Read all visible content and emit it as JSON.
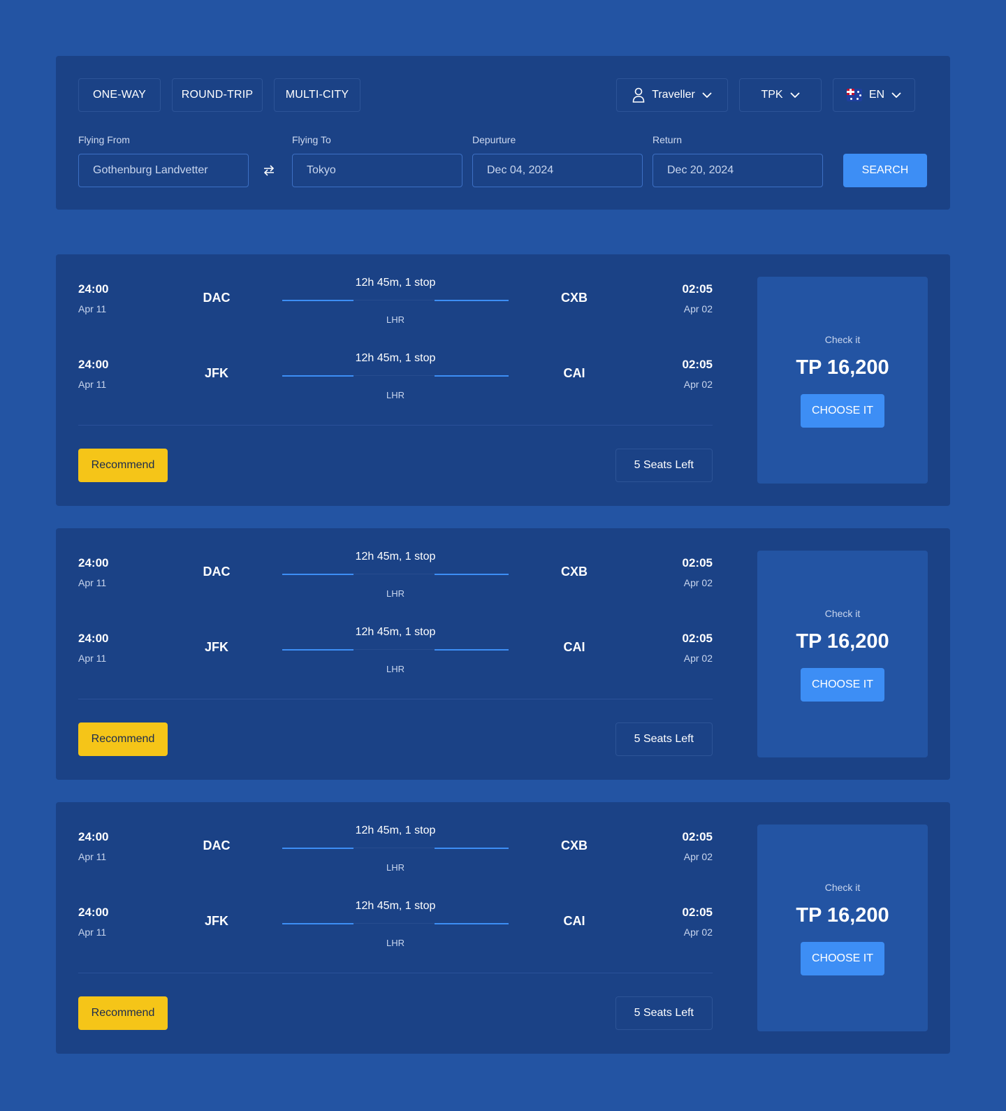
{
  "trip_types": [
    "ONE-WAY",
    "ROUND-TRIP",
    "MULTI-CITY"
  ],
  "traveller": {
    "label": "Traveller",
    "icon": "user-icon"
  },
  "currency": {
    "label": "TPK"
  },
  "language": {
    "label": "EN",
    "flag": "australia-flag-icon"
  },
  "form": {
    "from_label": "Flying From",
    "from_value": "Gothenburg Landvetter",
    "to_label": "Flying To",
    "to_value": "Tokyo",
    "departure_label": "Depurture",
    "departure_value": "Dec 04, 2024",
    "return_label": "Return",
    "return_value": "Dec 20, 2024",
    "search_label": "SEARCH"
  },
  "results": [
    {
      "legs": [
        {
          "dep_time": "24:00",
          "dep_date": "Apr 11",
          "dep_code": "DAC",
          "duration": "12h 45m, 1 stop",
          "stop": "LHR",
          "arr_code": "CXB",
          "arr_time": "02:05",
          "arr_date": "Apr 02"
        },
        {
          "dep_time": "24:00",
          "dep_date": "Apr 11",
          "dep_code": "JFK",
          "duration": "12h 45m, 1 stop",
          "stop": "LHR",
          "arr_code": "CAI",
          "arr_time": "02:05",
          "arr_date": "Apr 02"
        }
      ],
      "badge": "Recommend",
      "seats": "5 Seats Left",
      "check_label": "Check it",
      "price": "TP 16,200",
      "choose_label": "CHOOSE IT"
    },
    {
      "legs": [
        {
          "dep_time": "24:00",
          "dep_date": "Apr 11",
          "dep_code": "DAC",
          "duration": "12h 45m, 1 stop",
          "stop": "LHR",
          "arr_code": "CXB",
          "arr_time": "02:05",
          "arr_date": "Apr 02"
        },
        {
          "dep_time": "24:00",
          "dep_date": "Apr 11",
          "dep_code": "JFK",
          "duration": "12h 45m, 1 stop",
          "stop": "LHR",
          "arr_code": "CAI",
          "arr_time": "02:05",
          "arr_date": "Apr 02"
        }
      ],
      "badge": "Recommend",
      "seats": "5 Seats Left",
      "check_label": "Check it",
      "price": "TP 16,200",
      "choose_label": "CHOOSE IT"
    },
    {
      "legs": [
        {
          "dep_time": "24:00",
          "dep_date": "Apr 11",
          "dep_code": "DAC",
          "duration": "12h 45m, 1 stop",
          "stop": "LHR",
          "arr_code": "CXB",
          "arr_time": "02:05",
          "arr_date": "Apr 02"
        },
        {
          "dep_time": "24:00",
          "dep_date": "Apr 11",
          "dep_code": "JFK",
          "duration": "12h 45m, 1 stop",
          "stop": "LHR",
          "arr_code": "CAI",
          "arr_time": "02:05",
          "arr_date": "Apr 02"
        }
      ],
      "badge": "Recommend",
      "seats": "5 Seats Left",
      "check_label": "Check it",
      "price": "TP 16,200",
      "choose_label": "CHOOSE IT"
    }
  ],
  "colors": {
    "page_bg": "#2354a3",
    "panel_bg": "#1b4286",
    "accent": "#3d8ef5",
    "badge": "#f5c518"
  }
}
